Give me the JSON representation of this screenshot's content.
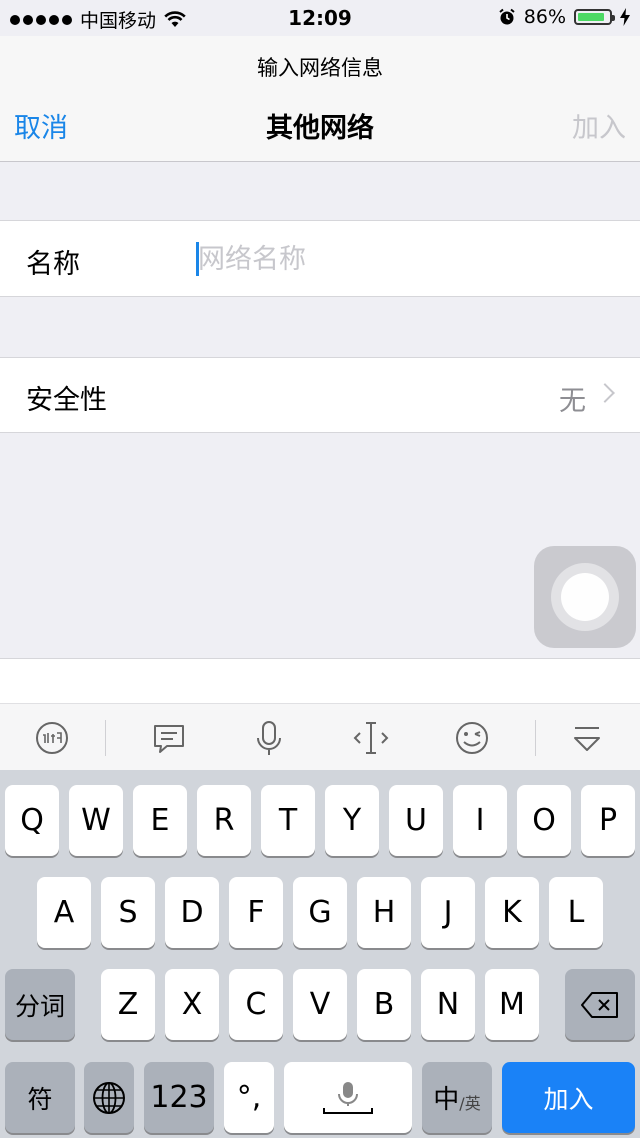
{
  "status_bar": {
    "carrier": "中国移动",
    "time": "12:09",
    "battery_percent": "86%",
    "battery_level": 0.86,
    "icons": [
      "signal-dots-icon",
      "wifi-icon",
      "alarm-icon",
      "battery-icon",
      "charging-bolt-icon"
    ]
  },
  "nav": {
    "prompt": "输入网络信息",
    "cancel_label": "取消",
    "title": "其他网络",
    "join_label": "加入"
  },
  "form": {
    "name_label": "名称",
    "name_placeholder": "网络名称",
    "name_value": "",
    "security_label": "安全性",
    "security_value": "无"
  },
  "toolbar": {
    "icons": [
      "ifly-logo-icon",
      "message-icon",
      "microphone-icon",
      "cursor-move-icon",
      "emoji-icon",
      "keyboard-hide-icon"
    ]
  },
  "keyboard": {
    "row1": [
      "Q",
      "W",
      "E",
      "R",
      "T",
      "Y",
      "U",
      "I",
      "O",
      "P"
    ],
    "row2": [
      "A",
      "S",
      "D",
      "F",
      "G",
      "H",
      "J",
      "K",
      "L"
    ],
    "row3": [
      "Z",
      "X",
      "C",
      "V",
      "B",
      "N",
      "M"
    ],
    "segment_label": "分词",
    "symbols_label": "符",
    "numbers_label": "123",
    "punct_label": "°,",
    "lang_main": "中",
    "lang_alt": "/英",
    "join_label": "加入",
    "accent_color": "#1a82f7"
  }
}
